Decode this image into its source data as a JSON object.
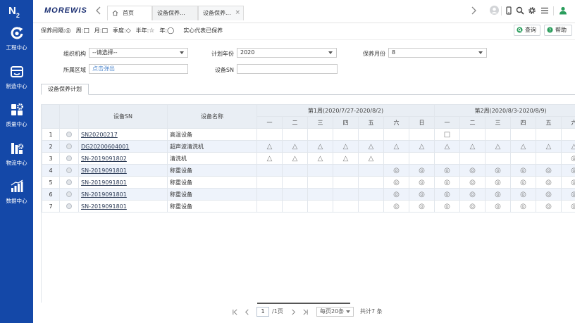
{
  "sidebar": {
    "logo": "N",
    "logo_sub": "2",
    "items": [
      {
        "label": "工程中心",
        "icon": "engineering-icon"
      },
      {
        "label": "制造中心",
        "icon": "manufacturing-icon"
      },
      {
        "label": "质量中心",
        "icon": "quality-icon"
      },
      {
        "label": "物流中心",
        "icon": "logistics-icon"
      },
      {
        "label": "数据中心",
        "icon": "data-chart-icon"
      }
    ]
  },
  "topbar": {
    "brand": "MOREWIS",
    "tabs": [
      {
        "label": "首页",
        "icon": "home-icon",
        "active": false
      },
      {
        "label": "设备保养...",
        "active": false
      },
      {
        "label": "设备保养...",
        "active": true,
        "close": "×"
      }
    ],
    "actions": [
      "avatar-icon",
      "device-icon",
      "search-icon",
      "gear-icon",
      "menu-icon",
      "user-icon"
    ]
  },
  "legend": {
    "items": [
      {
        "label": "保养间隔:",
        "symbol": "◎"
      },
      {
        "label": "周:",
        "symbol": "□"
      },
      {
        "label": "月:",
        "symbol": "□"
      },
      {
        "label": "季度:",
        "symbol": "◇"
      },
      {
        "label": "半年:",
        "symbol": "☆"
      },
      {
        "label": "年:",
        "symbol": "◯"
      }
    ],
    "note": "实心代表已保养"
  },
  "toolbar": {
    "query_label": "查询",
    "help_label": "帮助"
  },
  "filters": {
    "org": {
      "label": "组织机构",
      "value": "--请选择--"
    },
    "year": {
      "label": "计划年份",
      "value": "2020"
    },
    "month": {
      "label": "保养月份",
      "value": "8"
    },
    "area": {
      "label": "所属区域",
      "placeholder": "点击弹出"
    },
    "sn": {
      "label": "设备SN",
      "value": ""
    }
  },
  "panel": {
    "tab_label": "设备保养计划"
  },
  "table": {
    "headers": {
      "sn": "设备SN",
      "name": "设备名称"
    },
    "weeks": [
      {
        "label": "第1周(2020/7/27-2020/8/2)",
        "days": [
          "一",
          "二",
          "三",
          "四",
          "五",
          "六",
          "日"
        ]
      },
      {
        "label": "第2周(2020/8/3-2020/8/9)",
        "days": [
          "一",
          "二",
          "三",
          "四",
          "五",
          "六"
        ]
      }
    ],
    "rows": [
      {
        "num": "1",
        "sn": "SN20200217",
        "name": "高温设备",
        "marks": [
          "",
          "",
          "",
          "",
          "",
          "",
          "",
          "□",
          "",
          "",
          "",
          "",
          ""
        ]
      },
      {
        "num": "2",
        "sn": "DG20200604001",
        "name": "超声波清洗机",
        "marks": [
          "△",
          "△",
          "△",
          "△",
          "△",
          "△",
          "△",
          "△",
          "△",
          "△",
          "△",
          "△",
          "△"
        ]
      },
      {
        "num": "3",
        "sn": "SN-2019091802",
        "name": "清洗机",
        "marks": [
          "△",
          "△",
          "△",
          "△",
          "△",
          "",
          "",
          "",
          "",
          "",
          "",
          "",
          "◎"
        ]
      },
      {
        "num": "4",
        "sn": "SN-2019091801",
        "name": "称重设备",
        "marks": [
          "",
          "",
          "",
          "",
          "",
          "◎",
          "◎",
          "◎",
          "◎",
          "◎",
          "◎",
          "◎",
          "◎"
        ]
      },
      {
        "num": "5",
        "sn": "SN-2019091801",
        "name": "称重设备",
        "marks": [
          "",
          "",
          "",
          "",
          "",
          "◎",
          "◎",
          "◎",
          "◎",
          "◎",
          "◎",
          "◎",
          "◎"
        ]
      },
      {
        "num": "6",
        "sn": "SN-2019091801",
        "name": "称重设备",
        "marks": [
          "",
          "",
          "",
          "",
          "",
          "◎",
          "◎",
          "◎",
          "◎",
          "◎",
          "◎",
          "◎",
          "◎"
        ]
      },
      {
        "num": "7",
        "sn": "SN-2019091801",
        "name": "称重设备",
        "marks": [
          "",
          "",
          "",
          "",
          "",
          "◎",
          "◎",
          "◎",
          "◎",
          "◎",
          "◎",
          "◎",
          "◎"
        ]
      }
    ]
  },
  "pagination": {
    "page": "1",
    "total_pages": "/1页",
    "page_size": "每页20条",
    "total": "共计7 条"
  },
  "colors": {
    "sidebar": "#1448a8",
    "brand": "#1b2f72",
    "accent_green": "#2a9d5c",
    "row_stripe": "#eef3fb",
    "header_bg": "#e9eef4"
  }
}
